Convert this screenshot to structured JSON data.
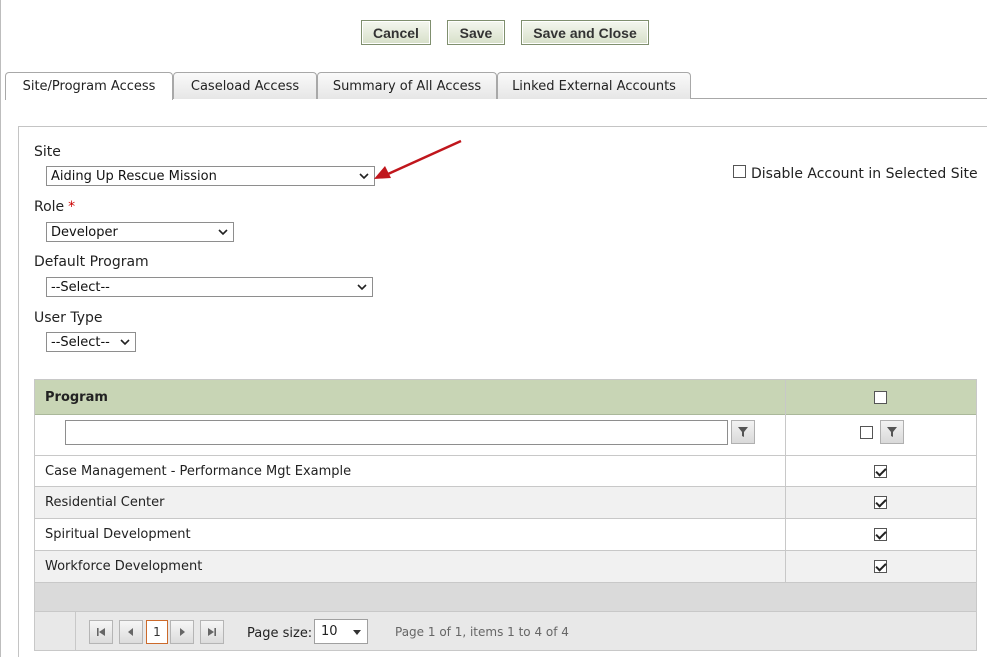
{
  "toolbar": {
    "cancel": "Cancel",
    "save": "Save",
    "save_close": "Save and Close"
  },
  "tabs": [
    {
      "label": "Site/Program Access",
      "active": true
    },
    {
      "label": "Caseload Access",
      "active": false
    },
    {
      "label": "Summary of All Access",
      "active": false
    },
    {
      "label": "Linked External Accounts",
      "active": false
    }
  ],
  "form": {
    "site_label": "Site",
    "site_value": "Aiding Up Rescue Mission",
    "disable_label": "Disable Account in Selected Site",
    "disable_checked": false,
    "role_label": "Role",
    "role_required": "*",
    "role_value": "Developer",
    "default_program_label": "Default Program",
    "default_program_value": "--Select--",
    "user_type_label": "User Type",
    "user_type_value": "--Select--"
  },
  "grid": {
    "column_program": "Program",
    "filter_value": "",
    "rows": [
      {
        "program": "Case Management - Performance Mgt Example",
        "checked": true
      },
      {
        "program": "Residential Center",
        "checked": true
      },
      {
        "program": "Spiritual Development",
        "checked": true
      },
      {
        "program": "Workforce Development",
        "checked": true
      }
    ]
  },
  "pager": {
    "current_page": "1",
    "page_size_label": "Page size:",
    "page_size_value": "10",
    "info": "Page 1 of 1, items 1 to 4 of 4"
  },
  "annotation_arrow_color": "#c0161c",
  "icons": [
    "chevron-down-icon",
    "filter-icon",
    "first-page-icon",
    "prev-page-icon",
    "next-page-icon",
    "last-page-icon",
    "arrow-annotation-icon"
  ]
}
